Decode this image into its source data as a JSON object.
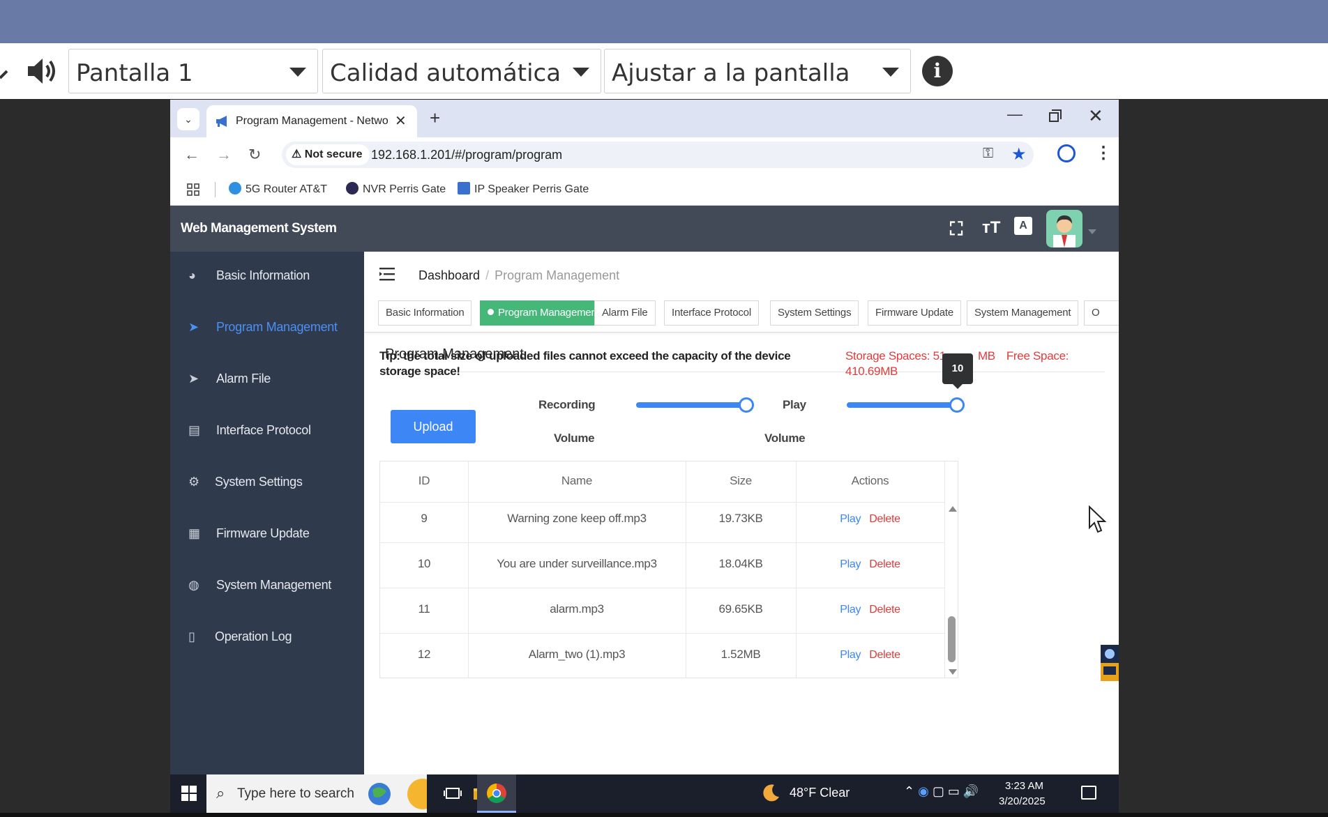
{
  "viewer": {
    "screen_select": "Pantalla 1",
    "quality_select": "Calidad automática",
    "fit_select": "Ajustar a la pantalla",
    "info_label": "i"
  },
  "browser": {
    "tab_title": "Program Management - Netwo",
    "close_glyph": "✕",
    "new_tab_glyph": "+",
    "not_secure": "Not secure",
    "url": "192.168.1.201/#/program/program",
    "bookmarks": [
      "5G Router AT&T",
      "NVR Perris Gate",
      "IP Speaker Perris Gate"
    ]
  },
  "app": {
    "title": "Web Management System"
  },
  "sidebar": {
    "items": [
      {
        "label": "Basic Information",
        "icon": "dashboard-icon"
      },
      {
        "label": "Program Management",
        "icon": "send-icon"
      },
      {
        "label": "Alarm File",
        "icon": "send-icon"
      },
      {
        "label": "Interface Protocol",
        "icon": "document-icon"
      },
      {
        "label": "System Settings",
        "icon": "gear-icon"
      },
      {
        "label": "Firmware Update",
        "icon": "grid-icon"
      },
      {
        "label": "System Management",
        "icon": "globe-icon"
      },
      {
        "label": "Operation Log",
        "icon": "log-icon"
      }
    ],
    "active_index": 1
  },
  "breadcrumb": {
    "root": "Dashboard",
    "separator": "/",
    "current": "Program Management"
  },
  "page_tabs": [
    "Basic Information",
    "Program Management",
    "Alarm File",
    "Interface Protocol",
    "System Settings",
    "Firmware Update",
    "System Management",
    "O"
  ],
  "program": {
    "title": "Program Management",
    "tip": "Tip: the total size of uploaded files cannot exceed the capacity of the device storage space!",
    "storage_label": "Storage Spaces: 51",
    "storage_tail": "MB",
    "free_label": "Free Space:",
    "free_value": "410.69MB",
    "upload_label": "Upload",
    "recording_label": "Recording",
    "recording_sub": "Volume",
    "recording_level": 1.0,
    "play_label": "Play",
    "play_sub": "Volume",
    "play_level": 1.0,
    "play_tooltip": "10"
  },
  "table": {
    "headers": [
      "ID",
      "Name",
      "Size",
      "Actions"
    ],
    "rows": [
      {
        "id": "9",
        "name": "Warning zone keep off.mp3",
        "size": "19.73KB"
      },
      {
        "id": "10",
        "name": "You are under surveillance.mp3",
        "size": "18.04KB"
      },
      {
        "id": "11",
        "name": "alarm.mp3",
        "size": "69.65KB"
      },
      {
        "id": "12",
        "name": "Alarm_two (1).mp3",
        "size": "1.52MB"
      }
    ],
    "play_action": "Play",
    "delete_action": "Delete"
  },
  "taskbar": {
    "search_placeholder": "Type here to search",
    "weather": "48°F  Clear",
    "time": "3:23 AM",
    "date": "3/20/2025"
  },
  "colors": {
    "viewer_bar": "#6a7aa6",
    "header": "#424957",
    "sidebar": "#2f3a4c",
    "accent": "#3c86f5",
    "active_tab": "#45b879",
    "danger": "#e23b3b"
  }
}
